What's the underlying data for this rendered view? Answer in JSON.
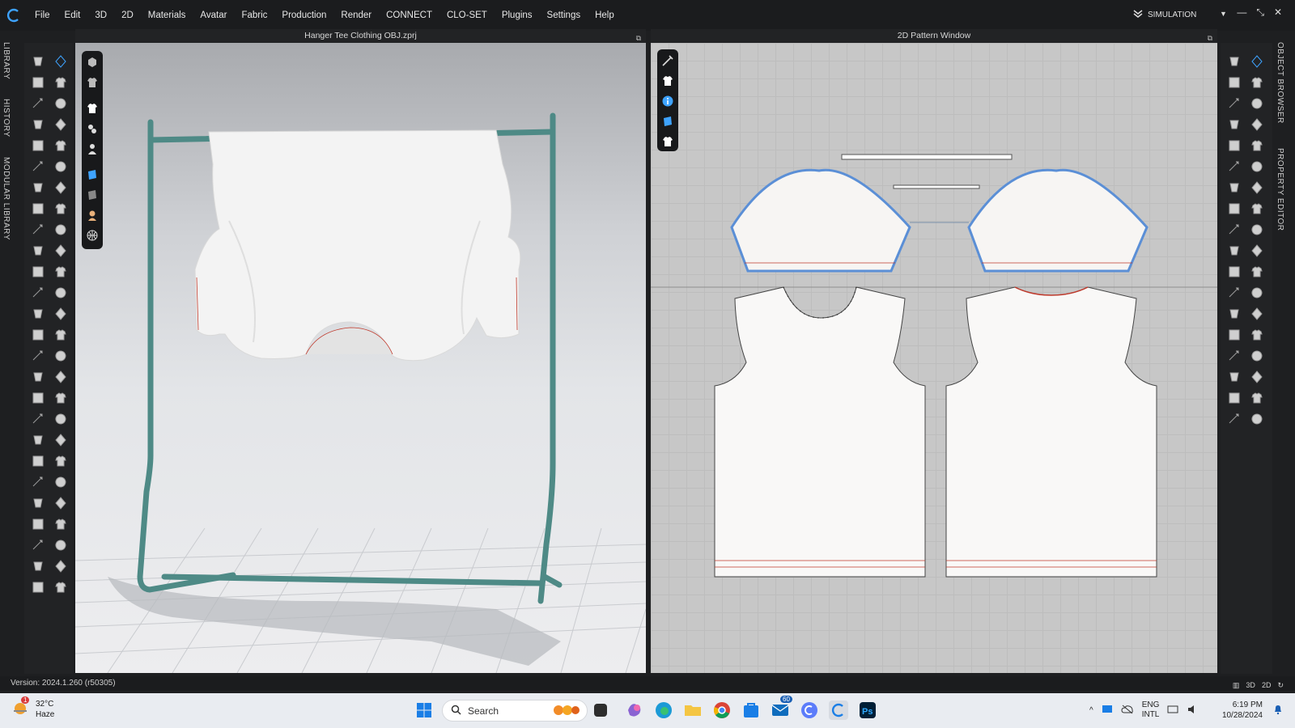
{
  "menu": [
    "File",
    "Edit",
    "3D",
    "2D",
    "Materials",
    "Avatar",
    "Fabric",
    "Production",
    "Render",
    "CONNECT",
    "CLO-SET",
    "Plugins",
    "Settings",
    "Help"
  ],
  "mode": "SIMULATION",
  "left_tabs": [
    "LIBRARY",
    "HISTORY",
    "MODULAR LIBRARY"
  ],
  "right_tabs": [
    "OBJECT BROWSER",
    "PROPERTY EDITOR"
  ],
  "viewport3d": {
    "title": "Hanger Tee Clothing OBJ.zprj"
  },
  "pattern2d": {
    "title": "2D Pattern Window"
  },
  "status": {
    "version": "Version: 2024.1.260 (r50305)",
    "view_modes": [
      "2D",
      "3D"
    ]
  },
  "taskbar": {
    "weather_temp": "32°C",
    "weather_desc": "Haze",
    "weather_badge": "1",
    "search_placeholder": "Search",
    "mail_badge": "60",
    "lang_1": "ENG",
    "lang_2": "INTL",
    "time": "6:19 PM",
    "date": "10/28/2024"
  },
  "colors": {
    "rack": "#4e8a86",
    "accent": "#3ea3ff",
    "seam_red": "#c0392b",
    "selected_outline": "#5b8fd6"
  }
}
